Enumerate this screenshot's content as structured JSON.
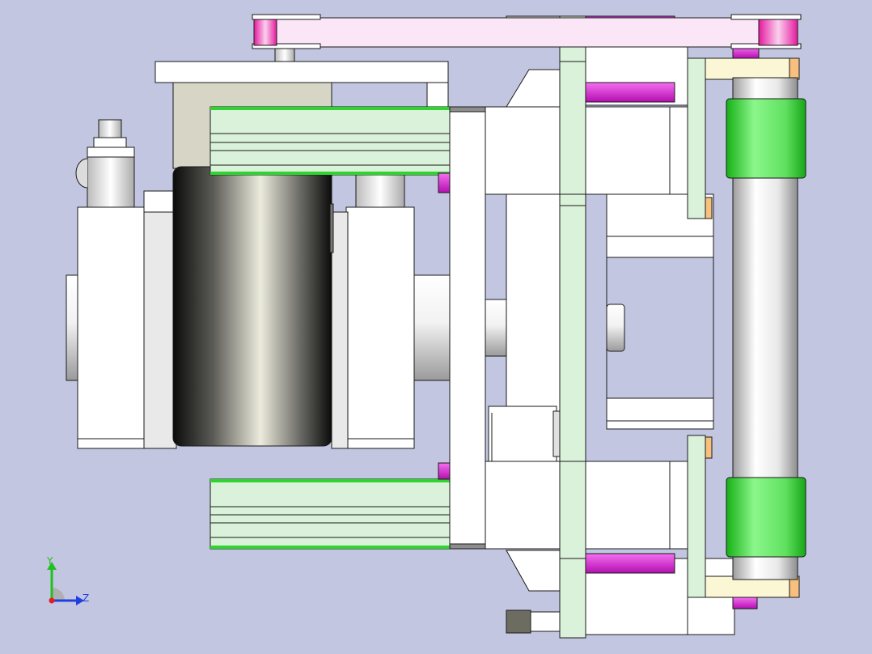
{
  "viewport": {
    "background": "#c3c6e0",
    "colors": {
      "part_white": "#ffffff",
      "edge": "#1a1a1a",
      "light_green": "#d9f2d9",
      "bright_green": "#7ff07f",
      "magenta": "#e43fd8",
      "pink": "#fbe6f7",
      "cream": "#fbf6d4",
      "orange": "#f7c07f",
      "steel": "#c8c8c8",
      "motor_dark": "#1a1a1a",
      "motor_light": "#e7e6d8",
      "gearbox": "#d7d6c6"
    }
  },
  "triad": {
    "y_label": "Y",
    "z_label": "Z",
    "y_color": "#21c021",
    "z_color": "#1f3fe0",
    "x_color": "#e02020"
  }
}
